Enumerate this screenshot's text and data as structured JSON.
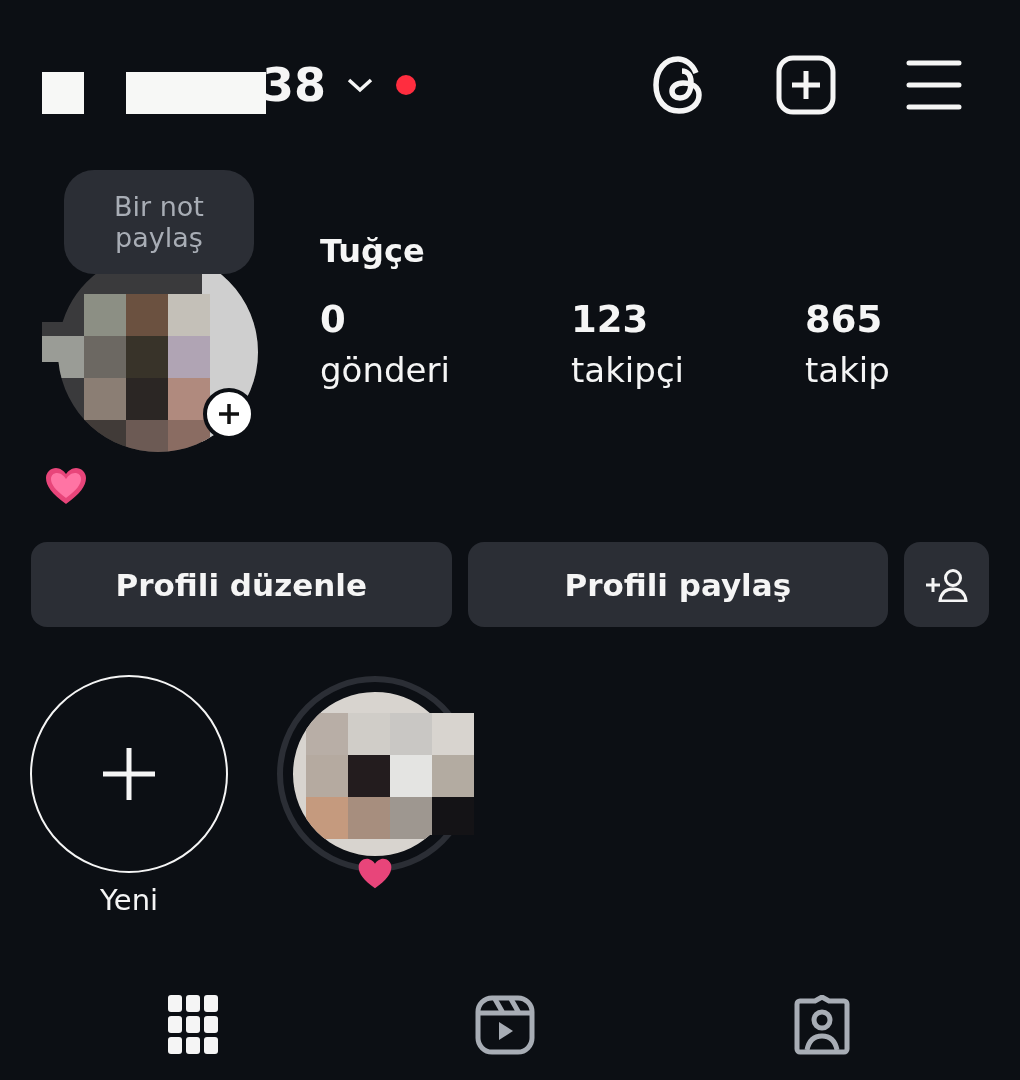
{
  "header": {
    "username": "38",
    "has_notification": true
  },
  "note": {
    "text": "Bir not paylaş"
  },
  "profile": {
    "name": "Tuğçe",
    "stats": [
      {
        "value": "0",
        "label": "gönderi"
      },
      {
        "value": "123",
        "label": "takipçi"
      },
      {
        "value": "865",
        "label": "takip"
      }
    ]
  },
  "buttons": [
    "Profili düzenle",
    "Profili paylaş"
  ],
  "highlights": [
    {
      "kind": "new",
      "label": "Yeni"
    },
    {
      "kind": "story"
    }
  ],
  "tabs": [
    {
      "kind": "grid",
      "selected": true
    },
    {
      "kind": "reels",
      "selected": false
    },
    {
      "kind": "tagged",
      "selected": false
    }
  ]
}
